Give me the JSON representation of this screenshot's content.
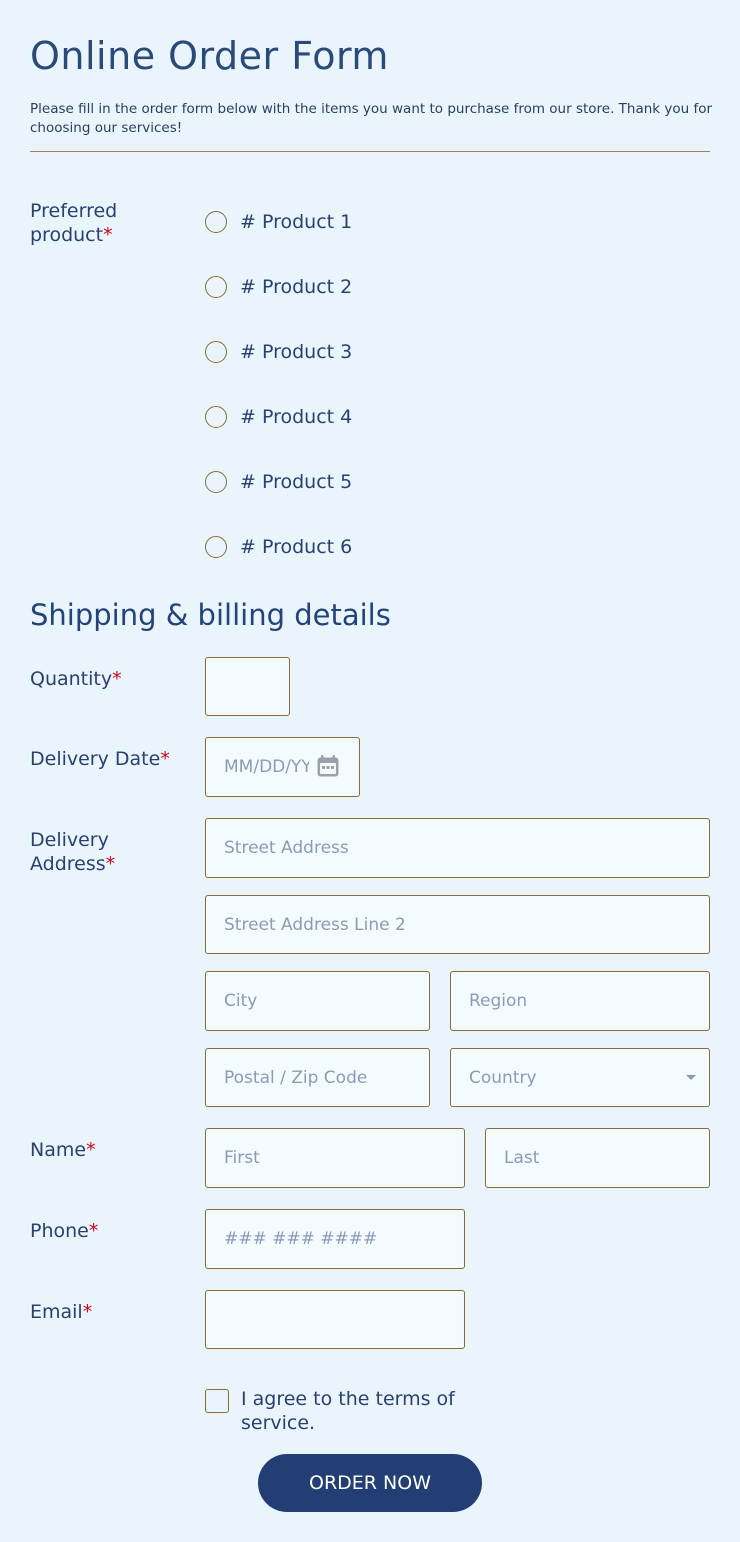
{
  "header": {
    "title": "Online Order Form",
    "subtitle": "Please fill in the order form below with the items you want to purchase from our store. Thank you for choosing our services!"
  },
  "product": {
    "label_line1": "Preferred",
    "label_line2": "product",
    "required_mark": "*",
    "options": [
      "# Product 1",
      "# Product 2",
      "# Product 3",
      "# Product 4",
      "# Product 5",
      "# Product 6"
    ]
  },
  "shipping": {
    "section_title": "Shipping & billing details",
    "quantity_label": "Quantity",
    "delivery_date_label": "Delivery Date",
    "delivery_date_placeholder": "MM/DD/YYYY",
    "address_label_line1": "Delivery",
    "address_label_line2": "Address",
    "street_placeholder": "Street Address",
    "street2_placeholder": "Street Address Line 2",
    "city_placeholder": "City",
    "region_placeholder": "Region",
    "postal_placeholder": "Postal / Zip Code",
    "country_placeholder": "Country",
    "name_label": "Name",
    "first_placeholder": "First",
    "last_placeholder": "Last",
    "phone_label": "Phone",
    "phone_placeholder": "### ### ####",
    "email_label": "Email",
    "required_mark": "*"
  },
  "terms": {
    "label": "I agree to the terms of service."
  },
  "submit": {
    "label": "ORDER NOW"
  },
  "colors": {
    "background": "#e9f5fb",
    "heading": "#2a4a7a",
    "border": "#8a6a3a",
    "required": "#d0021b",
    "button": "#223e74"
  },
  "icons": {
    "date": "calendar-icon",
    "country_dropdown": "chevron-down-icon"
  }
}
